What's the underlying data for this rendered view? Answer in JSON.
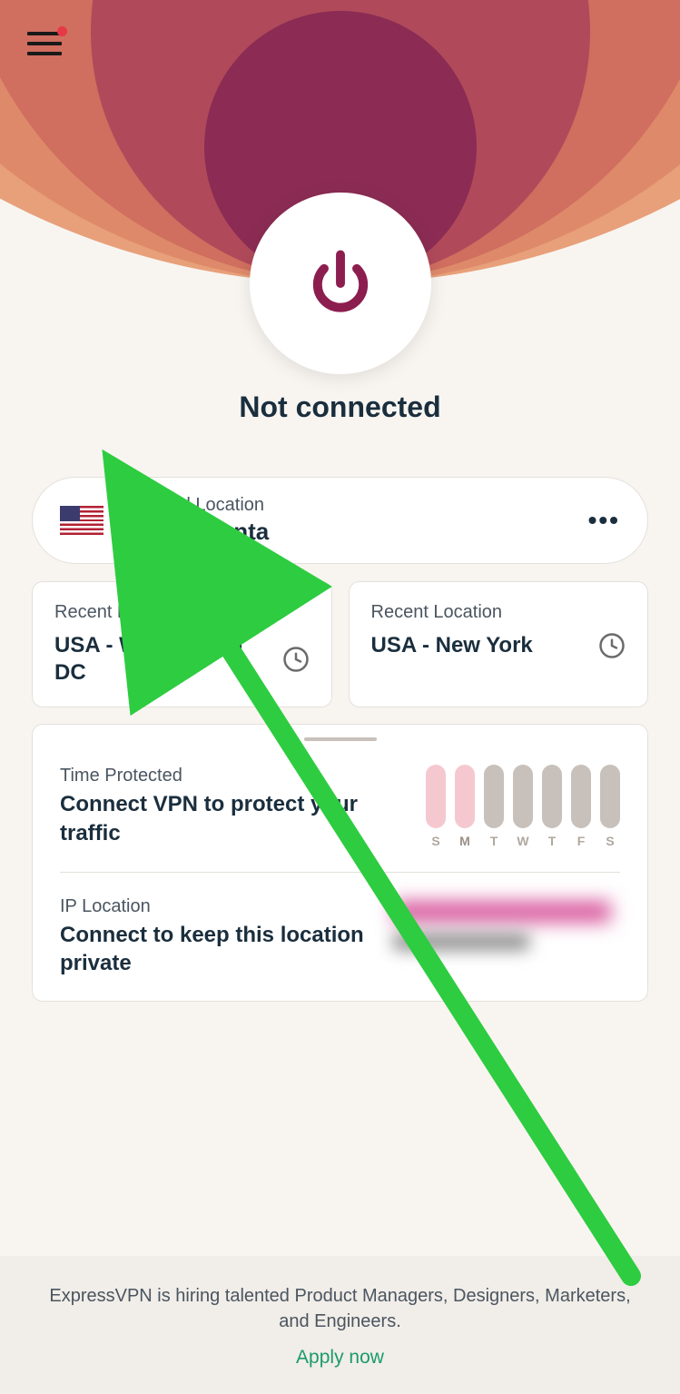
{
  "status": "Not connected",
  "selectedLocation": {
    "label": "Selected Location",
    "value": "USA - Atlanta"
  },
  "recent": [
    {
      "label": "Recent Location",
      "name": "USA - Washington DC"
    },
    {
      "label": "Recent Location",
      "name": "USA - New York"
    }
  ],
  "timeProtected": {
    "label": "Time Protected",
    "value": "Connect VPN to protect your traffic",
    "days": [
      "S",
      "M",
      "T",
      "W",
      "T",
      "F",
      "S"
    ]
  },
  "ipLocation": {
    "label": "IP Location",
    "value": "Connect to keep this location private"
  },
  "footer": {
    "text": "ExpressVPN is hiring talented Product Managers, Designers, Marketers, and Engineers.",
    "link": "Apply now"
  }
}
